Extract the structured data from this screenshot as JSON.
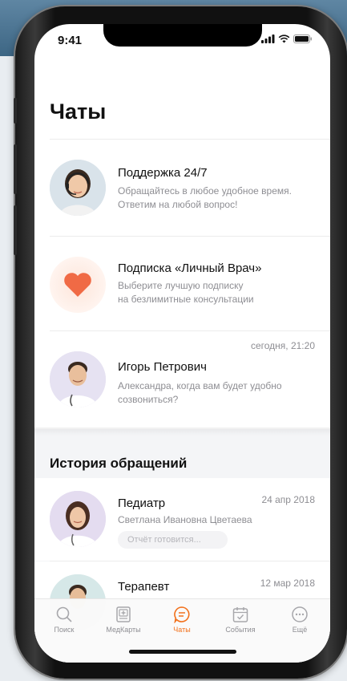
{
  "status_bar": {
    "time": "9:41"
  },
  "page_title": "Чаты",
  "chats": [
    {
      "title": "Поддержка 24/7",
      "line1": "Обращайтесь в любое удобное время.",
      "line2": "Ответим на любой вопрос!",
      "time": ""
    },
    {
      "title": "Подписка «Личный Врач»",
      "line1": "Выберите лучшую подписку",
      "line2": "на безлимитные консультации",
      "time": ""
    },
    {
      "title": "Игорь Петрович",
      "line1": "Александра, когда вам будет удобно",
      "line2": "созвониться?",
      "time": "сегодня, 21:20"
    }
  ],
  "history": {
    "title": "История обращений",
    "items": [
      {
        "title": "Педиатр",
        "doctor": "Светлана Ивановна Цветаева",
        "date": "24 апр 2018",
        "status": "Отчёт готовится..."
      },
      {
        "title": "Терапевт",
        "doctor": "",
        "date": "12 мар 2018",
        "status": ""
      }
    ]
  },
  "tabs": [
    {
      "label": "Поиск",
      "icon": "search-icon"
    },
    {
      "label": "МедКарты",
      "icon": "medcard-icon"
    },
    {
      "label": "Чаты",
      "icon": "chat-icon",
      "active": true
    },
    {
      "label": "События",
      "icon": "calendar-icon"
    },
    {
      "label": "Ещё",
      "icon": "more-icon"
    }
  ],
  "colors": {
    "accent": "#f2711c",
    "muted": "#8e8e93"
  }
}
